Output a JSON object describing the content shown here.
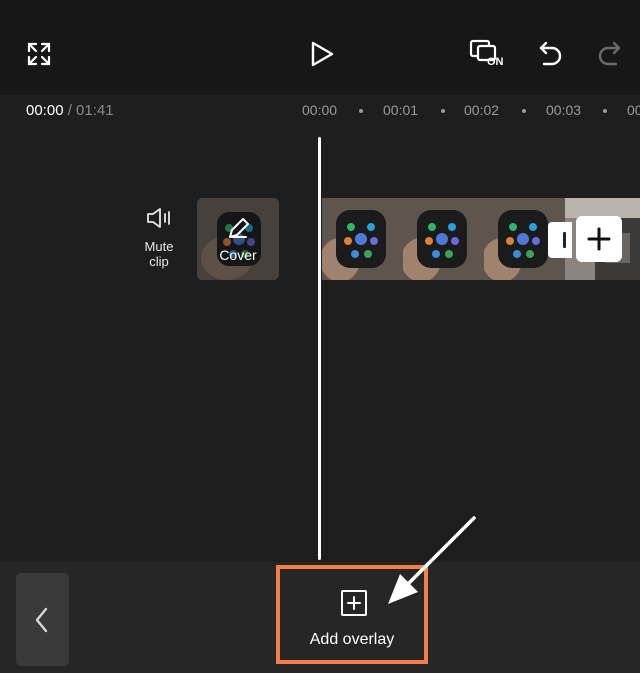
{
  "toolbar": {
    "fullscreen_icon": "expand-icon",
    "play_icon": "play-icon",
    "preview_toggle_label": "ON",
    "undo_icon": "undo-icon",
    "redo_icon": "redo-icon"
  },
  "timeline": {
    "current_time": "00:00",
    "duration": "/ 01:41",
    "ruler": [
      "00:00",
      "00:01",
      "00:02",
      "00:03",
      "00"
    ]
  },
  "track": {
    "mute_label_line1": "Mute",
    "mute_label_line2": "clip",
    "cover_label": "Cover",
    "add_clip_icon": "plus-icon"
  },
  "bottom_bar": {
    "back_icon": "chevron-left-icon",
    "add_overlay_label": "Add overlay"
  },
  "colors": {
    "highlight": "#f2804a",
    "background": "#1e1e1e"
  }
}
